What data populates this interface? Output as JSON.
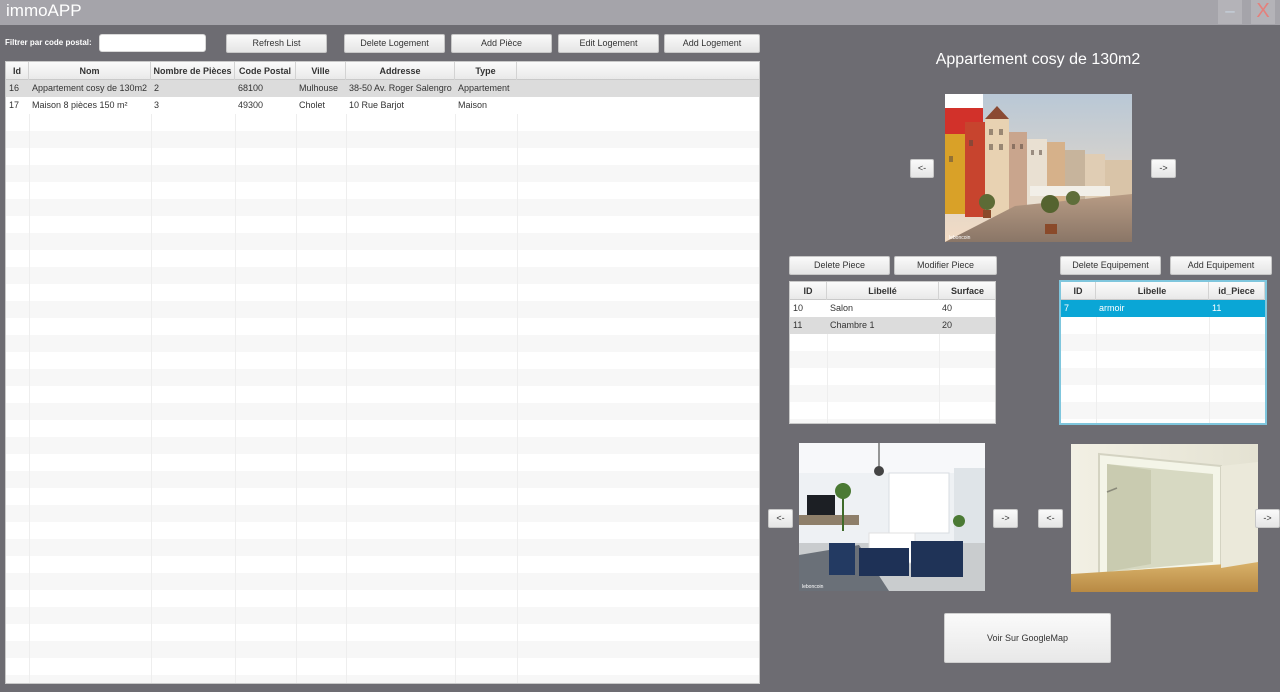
{
  "app": {
    "title": "immoAPP",
    "minimize_label": "–",
    "close_label": "X"
  },
  "toolbar": {
    "filter_label": "Filtrer par code postal:",
    "filter_value": "",
    "refresh": "Refresh List",
    "delete_logement": "Delete Logement",
    "add_piece": "Add Pièce",
    "edit_logement": "Edit Logement",
    "add_logement": "Add Logement"
  },
  "logements": {
    "columns": [
      "Id",
      "Nom",
      "Nombre de Pièces",
      "Code Postal",
      "Ville",
      "Addresse",
      "Type"
    ],
    "rows": [
      [
        "16",
        "Appartement cosy de 130m2",
        "2",
        "68100",
        "Mulhouse",
        "38-50 Av. Roger Salengro",
        "Appartement"
      ],
      [
        "17",
        "Maison 8 pièces 150 m²",
        "3",
        "49300",
        "Cholet",
        "10 Rue Barjot",
        "Maison"
      ]
    ]
  },
  "detail": {
    "title": "Appartement cosy de 130m2",
    "prev_label": "<-",
    "next_label": "->",
    "photo_watermark": "leboncoin"
  },
  "pieces": {
    "delete": "Delete Piece",
    "modify": "Modifier Piece",
    "columns": [
      "ID",
      "Libellé",
      "Surface"
    ],
    "rows": [
      [
        "10",
        "Salon",
        "40"
      ],
      [
        "11",
        "Chambre 1",
        "20"
      ]
    ]
  },
  "equipements": {
    "delete": "Delete Equipement",
    "add": "Add Equipement",
    "columns": [
      "ID",
      "Libelle",
      "id_Piece"
    ],
    "rows": [
      [
        "7",
        "armoir",
        "11"
      ]
    ],
    "selected_color": "#0aa6d6"
  },
  "map_button": "Voir Sur GoogleMap"
}
